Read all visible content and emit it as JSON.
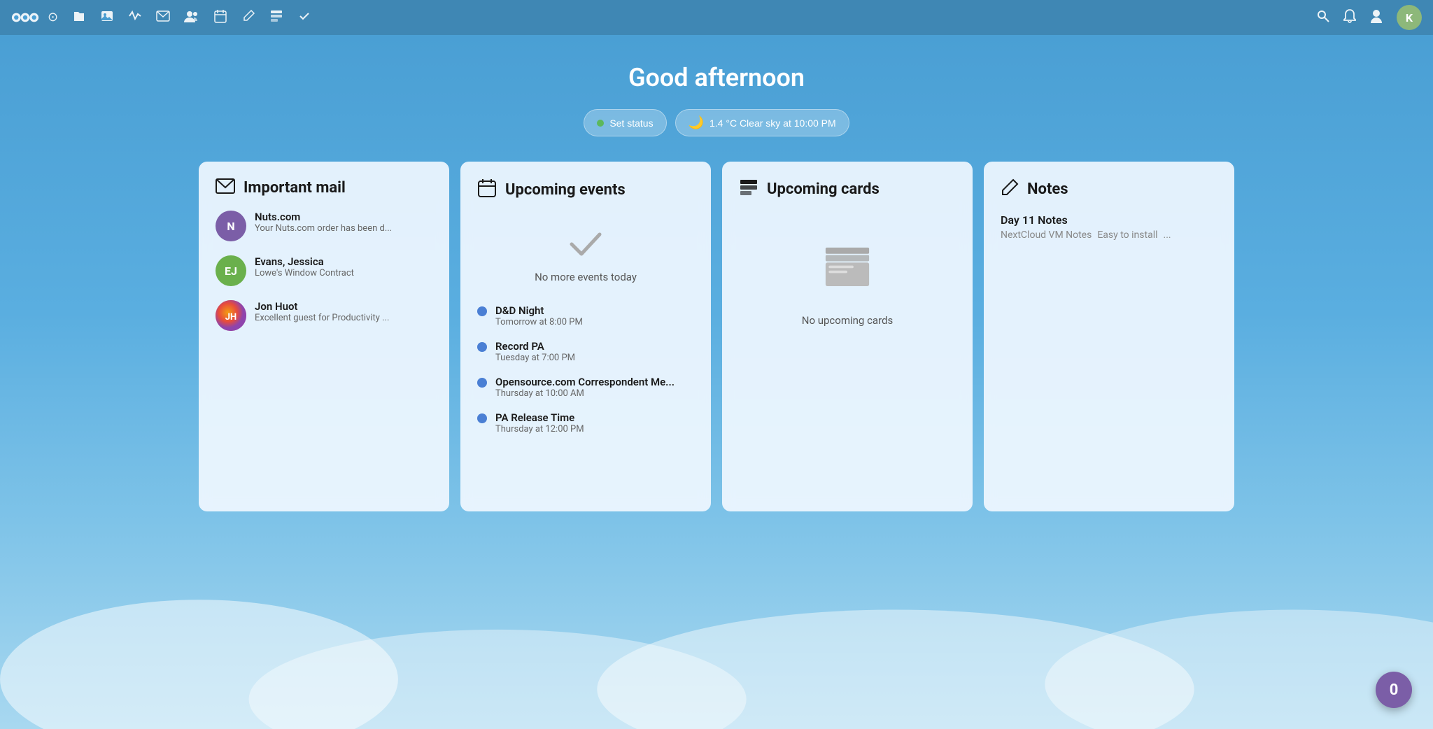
{
  "app": {
    "name": "Nextcloud"
  },
  "nav": {
    "icons": [
      "○",
      "▣",
      "🖼",
      "⚡",
      "✉",
      "👥",
      "📅",
      "✏",
      "▤",
      "✓"
    ],
    "right_icons": [
      "🔍",
      "🔔",
      "👤"
    ],
    "avatar_label": "K"
  },
  "header": {
    "greeting": "Good afternoon"
  },
  "status": {
    "set_status_label": "Set status",
    "weather_label": "1.4 °C  Clear sky at 10:00 PM"
  },
  "important_mail": {
    "title": "Important mail",
    "items": [
      {
        "sender": "Nuts.com",
        "preview": "Your Nuts.com order has been d...",
        "avatar_label": "N",
        "avatar_color": "#7b5ea7"
      },
      {
        "sender": "Evans, Jessica",
        "preview": "Lowe's Window Contract",
        "avatar_label": "EJ",
        "avatar_color": "#6ab04c"
      },
      {
        "sender": "Jon Huot",
        "preview": "Excellent guest for Productivity ...",
        "avatar_label": "JH",
        "avatar_color": "#e67e22",
        "avatar_image": true
      }
    ]
  },
  "upcoming_events": {
    "title": "Upcoming events",
    "no_events_text": "No more events today",
    "events": [
      {
        "name": "D&D Night",
        "time": "Tomorrow at 8:00 PM",
        "dot_color": "#4a7fd4"
      },
      {
        "name": "Record PA",
        "time": "Tuesday at 7:00 PM",
        "dot_color": "#4a7fd4"
      },
      {
        "name": "Opensource.com Correspondent Me...",
        "time": "Thursday at 10:00 AM",
        "dot_color": "#4a7fd4"
      },
      {
        "name": "PA Release Time",
        "time": "Thursday at 12:00 PM",
        "dot_color": "#4a7fd4"
      }
    ]
  },
  "upcoming_cards": {
    "title": "Upcoming cards",
    "no_cards_text": "No upcoming cards"
  },
  "notes": {
    "title": "Notes",
    "items": [
      {
        "title": "Day 11 Notes",
        "preview_parts": [
          "NextCloud VM Notes",
          "Easy to install",
          "..."
        ]
      }
    ]
  },
  "float_button": {
    "label": "0"
  }
}
